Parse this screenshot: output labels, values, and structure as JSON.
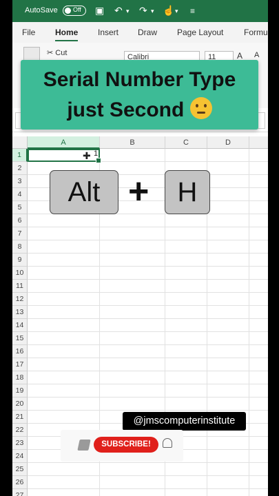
{
  "titlebar": {
    "autosave_label": "AutoSave",
    "autosave_state": "Off"
  },
  "ribbon": {
    "tabs": [
      "File",
      "Home",
      "Insert",
      "Draw",
      "Page Layout",
      "Formu"
    ],
    "active_tab": "Home",
    "cut_label": "Cut",
    "font_name": "Calibri",
    "font_size": "11"
  },
  "sheet": {
    "columns": [
      "A",
      "B",
      "C",
      "D"
    ],
    "rows": [
      "1",
      "2",
      "3",
      "4",
      "5",
      "6",
      "7",
      "8",
      "9",
      "10",
      "11",
      "12",
      "13",
      "14",
      "15",
      "16",
      "17",
      "18",
      "19",
      "20",
      "21",
      "22",
      "23",
      "24",
      "25",
      "26",
      "27"
    ],
    "active_cell": "A1",
    "cell_a1_value": "1"
  },
  "overlay": {
    "title_line1": "Serial Number Type",
    "title_line2": "just Second",
    "emoji": "thinking-face",
    "key1": "Alt",
    "key_plus": "+",
    "key2": "H",
    "handle": "@jmscomputerinstitute",
    "subscribe_label": "SUBSCRIBE!"
  },
  "colors": {
    "excel_green": "#217346",
    "banner_green": "#3dbb96",
    "subscribe_red": "#e0201b"
  }
}
